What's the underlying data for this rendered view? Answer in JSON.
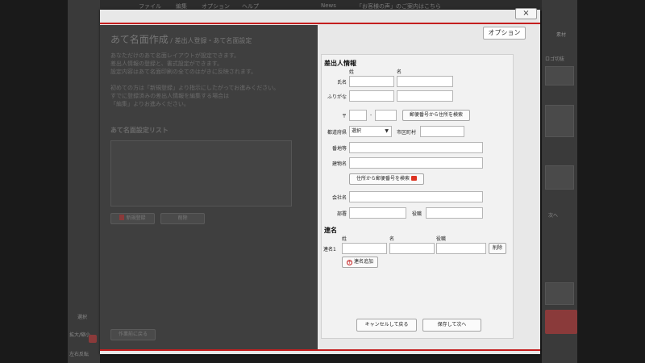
{
  "background": {
    "menu": [
      "ファイル",
      "編集",
      "オプション",
      "ヘルプ"
    ],
    "news": "News",
    "news_link": "「お客様の声」のご案内はこちら",
    "side_left": [
      "選択",
      "拡大/縮小",
      "左右反転"
    ],
    "side_right": [
      "素材",
      "ロゴ切抜",
      "次へ"
    ],
    "rotate_label": "左右反転"
  },
  "modal": {
    "close_label": "×",
    "title": "あて名面作成",
    "subtitle": " / 差出人登録・あて名面設定",
    "description": [
      "あなただけのあて名面レイアウトが設定できます。",
      "差出人情報の登録と、書式設定ができます。",
      "設定内容はあて名面印刷の全てのはがきに反映されます。",
      "",
      "初めての方は「新規登録」より指示にしたがってお進みください。",
      "すでに登録済みの差出人情報を編集する場合は",
      "「編集」よりお進みください。"
    ],
    "list_heading": "あて名面設定リスト",
    "new_button": "新規登録",
    "delete_button": "削除",
    "back_button": "作業前に戻る",
    "options_button": "オプション"
  },
  "form": {
    "sender_heading": "差出人情報",
    "col_sei": "姓",
    "col_mei": "名",
    "name_label": "氏名",
    "furigana_label": "ふりがな",
    "postal_mark": "〒",
    "postal_dash": "-",
    "postal_search_button": "郵便番号から住所を検索",
    "prefecture_label": "都道府県",
    "prefecture_value": "選択",
    "city_label": "市区町村",
    "street_label": "番地等",
    "building_label": "建物名",
    "address_search_button": "住所から郵便番号を検索",
    "company_label": "会社名",
    "department_label": "部署",
    "title_label": "役職",
    "joint_heading": "連名",
    "joint_col_sei": "姓",
    "joint_col_mei": "名",
    "joint_col_title": "役職",
    "joint1_label": "連名1",
    "joint_delete_button": "削除",
    "joint_add_button": "連名追加",
    "cancel_button": "キャンセルして戻る",
    "save_button": "保存して次へ"
  }
}
